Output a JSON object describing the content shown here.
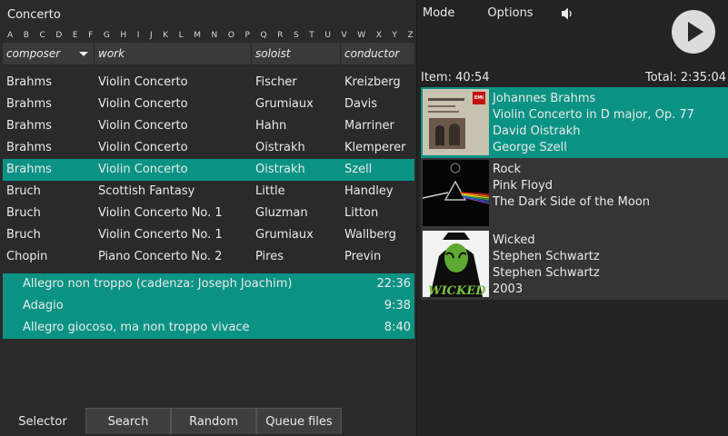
{
  "selector": {
    "genre": "Concerto",
    "alphabet": [
      "A",
      "B",
      "C",
      "D",
      "E",
      "F",
      "G",
      "H",
      "I",
      "J",
      "K",
      "L",
      "M",
      "N",
      "O",
      "P",
      "Q",
      "R",
      "S",
      "T",
      "U",
      "V",
      "W",
      "X",
      "Y",
      "Z"
    ],
    "columns": {
      "composer": "composer",
      "work": "work",
      "soloist": "soloist",
      "conductor": "conductor"
    },
    "rows": [
      {
        "composer": "Brahms",
        "work": "Violin Concerto",
        "soloist": "Fischer",
        "conductor": "Kreizberg"
      },
      {
        "composer": "Brahms",
        "work": "Violin Concerto",
        "soloist": "Grumiaux",
        "conductor": "Davis"
      },
      {
        "composer": "Brahms",
        "work": "Violin Concerto",
        "soloist": "Hahn",
        "conductor": "Marriner"
      },
      {
        "composer": "Brahms",
        "work": "Violin Concerto",
        "soloist": "Oistrakh",
        "conductor": "Klemperer"
      },
      {
        "composer": "Brahms",
        "work": "Violin Concerto",
        "soloist": "Oistrakh",
        "conductor": "Szell"
      },
      {
        "composer": "Bruch",
        "work": "Scottish Fantasy",
        "soloist": "Little",
        "conductor": "Handley"
      },
      {
        "composer": "Bruch",
        "work": "Violin Concerto No. 1",
        "soloist": "Gluzman",
        "conductor": "Litton"
      },
      {
        "composer": "Bruch",
        "work": "Violin Concerto No. 1",
        "soloist": "Grumiaux",
        "conductor": "Wallberg"
      },
      {
        "composer": "Chopin",
        "work": "Piano Concerto No. 2",
        "soloist": "Pires",
        "conductor": "Previn"
      }
    ],
    "selected_row": 4,
    "tracks": [
      {
        "title": "Allegro non troppo (cadenza: Joseph Joachim)",
        "duration": "22:36"
      },
      {
        "title": "Adagio",
        "duration": "9:38"
      },
      {
        "title": "Allegro giocoso, ma non troppo vivace",
        "duration": "8:40"
      }
    ]
  },
  "tabs": [
    "Selector",
    "Search",
    "Random",
    "Queue files"
  ],
  "active_tab": 0,
  "menu": {
    "mode": "Mode",
    "options": "Options",
    "volume_icon": "speaker-icon",
    "play_icon": "play-icon"
  },
  "status": {
    "item": "Item:  40:54",
    "total": "Total:   2:35:04"
  },
  "queue": [
    {
      "line1": "Johannes Brahms",
      "line2": "Violin Concerto in D major, Op. 77",
      "line3": "David Oistrakh",
      "line4": "George Szell",
      "cover_text": "EMI"
    },
    {
      "line1": "Rock",
      "line2": "Pink Floyd",
      "line3": "The Dark Side of the Moon"
    },
    {
      "line1": "Wicked",
      "line2": "Stephen Schwartz",
      "line3": "Stephen Schwartz",
      "line4": "2003",
      "cover_text": "WICKED"
    }
  ],
  "colors": {
    "accent": "#0a9384",
    "background": "#2a2a2a",
    "panel": "#353535"
  }
}
